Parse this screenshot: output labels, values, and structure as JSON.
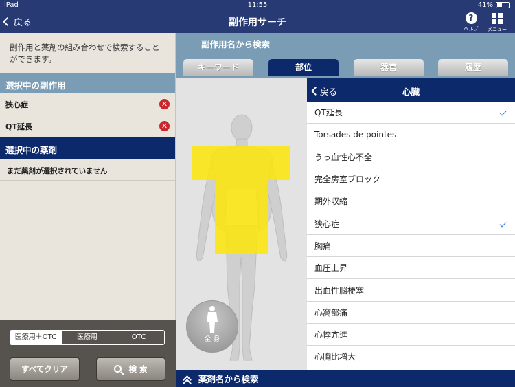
{
  "status_bar": {
    "device": "iPad",
    "time": "11:55",
    "battery": "41%",
    "battery_level": 0.41
  },
  "navbar": {
    "back_label": "戻る",
    "title": "副作用サーチ",
    "help_label": "ヘルプ",
    "menu_label": "メニュー"
  },
  "left": {
    "description": "副作用と薬剤の組み合わせで検索することができます。",
    "selected_side_effects_header": "選択中の副作用",
    "selected_side_effects": [
      "狭心症",
      "QT延長"
    ],
    "selected_drugs_header": "選択中の薬剤",
    "no_drug_text": "まだ薬剤が選択されていません",
    "filter_options": [
      "医療用＋OTC",
      "医療用",
      "OTC"
    ],
    "filter_selected": "医療用＋OTC",
    "clear_all_label": "すべてクリア",
    "search_label": "検 索"
  },
  "right": {
    "header": "副作用名から検索",
    "tabs": [
      "キーワード",
      "部位",
      "器官",
      "履歴"
    ],
    "active_tab": "部位",
    "whole_body_label": "全 身",
    "list_back_label": "戻る",
    "list_title": "心臓",
    "items": [
      {
        "label": "QT延長",
        "checked": "✓"
      },
      {
        "label": "Torsades de pointes",
        "checked": ""
      },
      {
        "label": "うっ血性心不全",
        "checked": ""
      },
      {
        "label": "完全房室ブロック",
        "checked": ""
      },
      {
        "label": "期外収縮",
        "checked": ""
      },
      {
        "label": "狭心症",
        "checked": "✓"
      },
      {
        "label": "胸痛",
        "checked": ""
      },
      {
        "label": "血圧上昇",
        "checked": ""
      },
      {
        "label": "出血性脳梗塞",
        "checked": ""
      },
      {
        "label": "心窩部痛",
        "checked": ""
      },
      {
        "label": "心悸亢進",
        "checked": ""
      },
      {
        "label": "心胸比増大",
        "checked": ""
      }
    ],
    "footer_label": "薬剤名から検索"
  },
  "colors": {
    "navy": "#0c2a6b",
    "nav_bar": "#283a73",
    "steel_blue": "#7a9db5",
    "highlight_yellow": "#ffe600",
    "delete_red": "#c8282b",
    "check_blue": "#2b6fd6"
  }
}
